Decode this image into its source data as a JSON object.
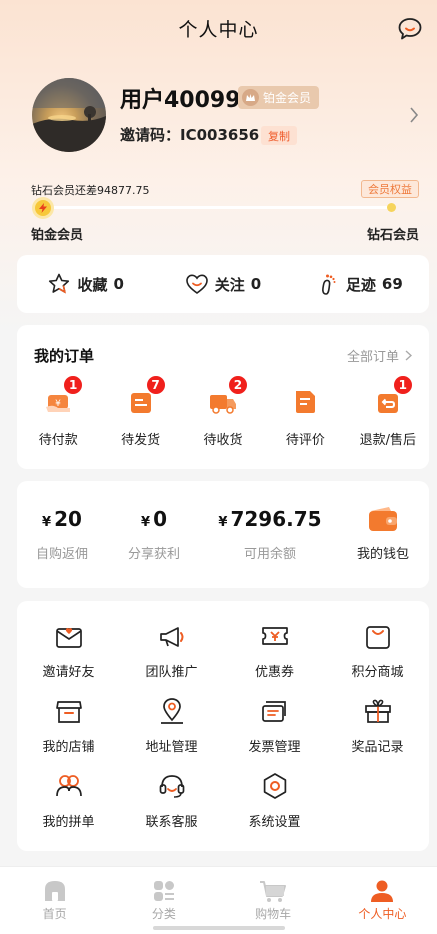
{
  "header": {
    "title": "个人中心",
    "message_icon": "chat-bubble-icon"
  },
  "profile": {
    "username": "用户40099",
    "vip_label": "铂金会员",
    "invite_text": "邀请码：IC003656",
    "copy_label": "复制"
  },
  "level": {
    "gap_text": "钻石会员还差94877.75",
    "rights_label": "会员权益",
    "current": "铂金会员",
    "next": "钻石会员",
    "progress": 0.04
  },
  "stats": [
    {
      "label": "收藏",
      "count": "0",
      "icon": "star-icon"
    },
    {
      "label": "关注",
      "count": "0",
      "icon": "heart-icon"
    },
    {
      "label": "足迹",
      "count": "69",
      "icon": "footprint-icon"
    }
  ],
  "orders": {
    "title": "我的订单",
    "all_label": "全部订单",
    "items": [
      {
        "label": "待付款",
        "badge": "1",
        "icon": "pay-icon"
      },
      {
        "label": "待发货",
        "badge": "7",
        "icon": "ship-box-icon"
      },
      {
        "label": "待收货",
        "badge": "2",
        "icon": "truck-icon"
      },
      {
        "label": "待评价",
        "badge": "",
        "icon": "review-icon"
      },
      {
        "label": "退款/售后",
        "badge": "1",
        "icon": "refund-icon"
      }
    ]
  },
  "wallet": {
    "currency": "¥",
    "items": [
      {
        "amount": "20",
        "label": "自购返佣"
      },
      {
        "amount": "0",
        "label": "分享获利"
      },
      {
        "amount": "7296.75",
        "label": "可用余额"
      }
    ],
    "wallet_label": "我的钱包"
  },
  "services": [
    {
      "label": "邀请好友",
      "icon": "invite-envelope-icon"
    },
    {
      "label": "团队推广",
      "icon": "megaphone-icon"
    },
    {
      "label": "优惠券",
      "icon": "coupon-icon"
    },
    {
      "label": "积分商城",
      "icon": "shopping-bag-icon"
    },
    {
      "label": "我的店铺",
      "icon": "store-icon"
    },
    {
      "label": "地址管理",
      "icon": "location-pin-icon"
    },
    {
      "label": "发票管理",
      "icon": "invoice-icon"
    },
    {
      "label": "奖品记录",
      "icon": "gift-icon"
    },
    {
      "label": "我的拼单",
      "icon": "group-buy-icon"
    },
    {
      "label": "联系客服",
      "icon": "headset-icon"
    },
    {
      "label": "系统设置",
      "icon": "settings-icon"
    }
  ],
  "tabbar": [
    {
      "label": "首页",
      "icon": "home-icon",
      "active": false
    },
    {
      "label": "分类",
      "icon": "category-icon",
      "active": false
    },
    {
      "label": "购物车",
      "icon": "cart-icon",
      "active": false
    },
    {
      "label": "个人中心",
      "icon": "user-icon",
      "active": true
    }
  ],
  "colors": {
    "accent": "#ee5d23",
    "badge": "#f0201c",
    "vip": "#e9c9ad"
  }
}
